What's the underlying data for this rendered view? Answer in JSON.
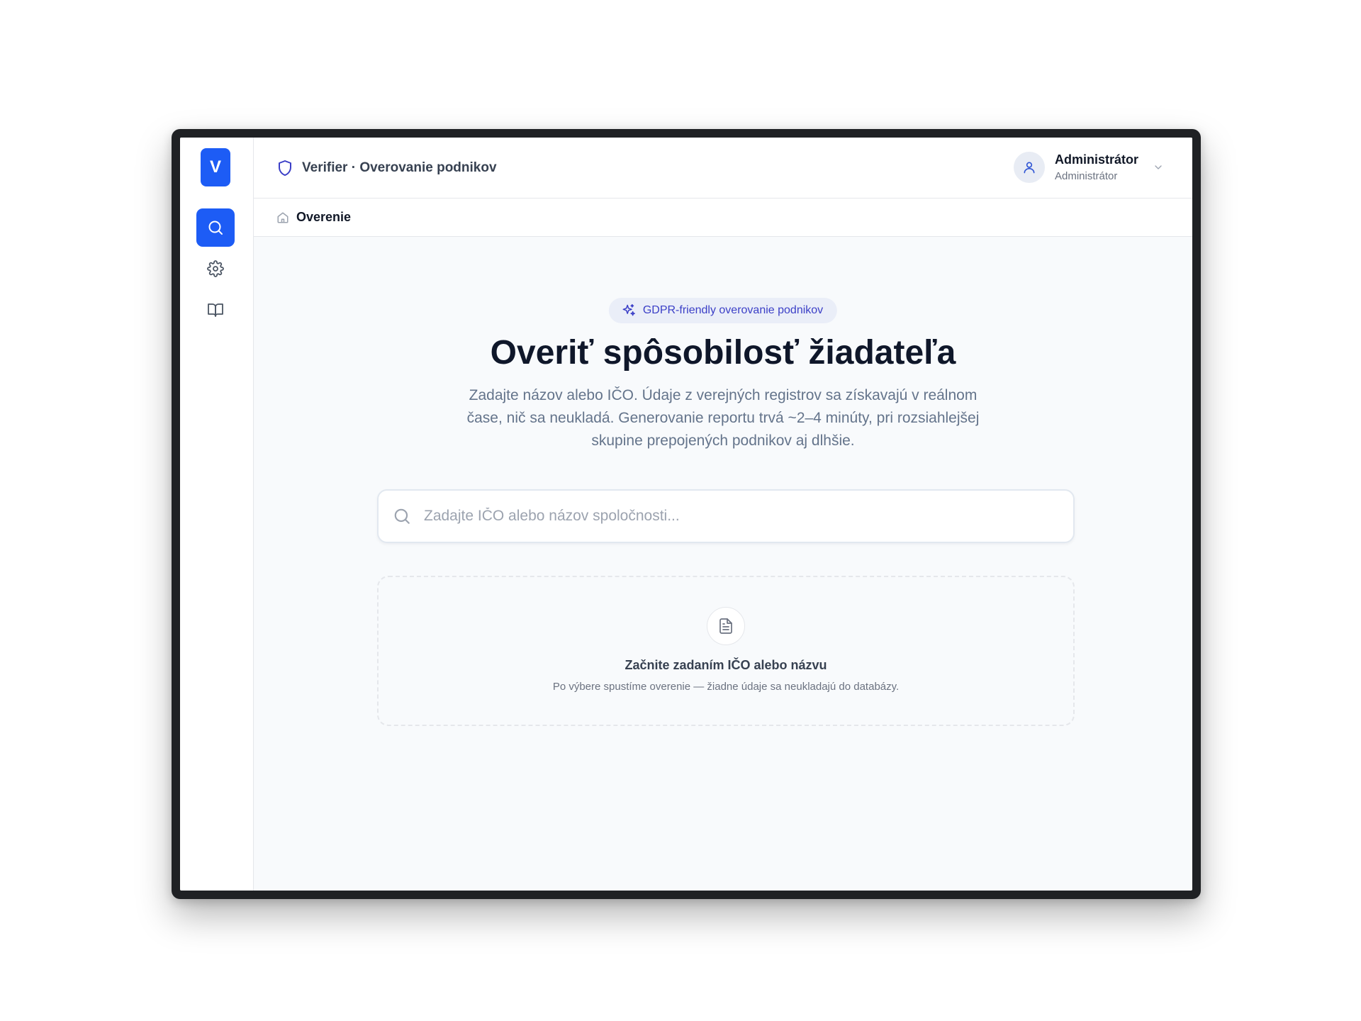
{
  "colors": {
    "accent": "#1d5cf5",
    "badge_bg": "#eaeef8",
    "badge_text": "#3b3fc7",
    "page_bg": "#f8fafc"
  },
  "sidebar": {
    "logo_letter": "V",
    "items": [
      {
        "icon": "search-icon",
        "active": true
      },
      {
        "icon": "gear-icon",
        "active": false
      },
      {
        "icon": "book-icon",
        "active": false
      }
    ]
  },
  "header": {
    "icon": "shield-icon",
    "title": "Verifier · Overovanie podnikov",
    "user": {
      "name": "Administrátor",
      "role": "Administrátor"
    }
  },
  "breadcrumb": {
    "icon": "home-icon",
    "label": "Overenie"
  },
  "main": {
    "badge": "GDPR-friendly overovanie podnikov",
    "title": "Overiť spôsobilosť žiadateľa",
    "description": "Zadajte názov alebo IČO. Údaje z verejných registrov sa získavajú v reálnom čase, nič sa neukladá. Generovanie reportu trvá ~2–4 minúty, pri rozsiahlejšej skupine prepojených podnikov aj dlhšie.",
    "search": {
      "placeholder": "Zadajte IČO alebo názov spoločnosti...",
      "value": ""
    },
    "empty_state": {
      "icon": "document-icon",
      "title": "Začnite zadaním IČO alebo názvu",
      "subtitle": "Po výbere spustíme overenie — žiadne údaje sa neukladajú do databázy."
    }
  }
}
